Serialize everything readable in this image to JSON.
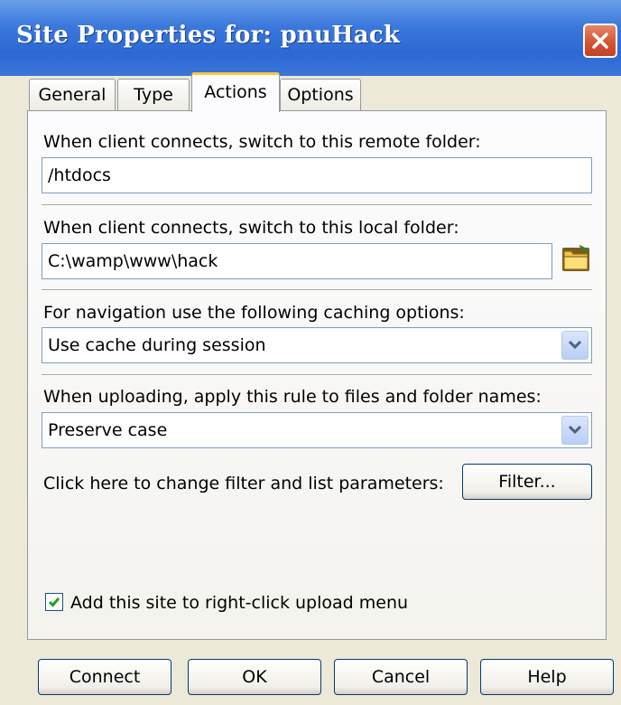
{
  "window": {
    "title": "Site Properties for: pnuHack"
  },
  "tabs": [
    {
      "label": "General"
    },
    {
      "label": "Type"
    },
    {
      "label": "Actions"
    },
    {
      "label": "Options"
    }
  ],
  "active_tab": "Actions",
  "actions": {
    "remote_folder_label": "When client connects, switch to this remote folder:",
    "remote_folder_value": "/htdocs",
    "local_folder_label": "When client connects, switch to this local folder:",
    "local_folder_value": "C:\\wamp\\www\\hack",
    "caching_label": "For navigation use the following caching options:",
    "caching_value": "Use cache during session",
    "upload_label": "When uploading, apply this rule to files and folder names:",
    "upload_value": "Preserve case",
    "filter_label": "Click here to change filter and list parameters:",
    "filter_button": "Filter...",
    "rightclick_label": "Add this site to right-click upload menu",
    "rightclick_checked": true
  },
  "buttons": {
    "connect": "Connect",
    "ok": "OK",
    "cancel": "Cancel",
    "help": "Help"
  },
  "icons": {
    "close": "close-icon",
    "folder": "folder-icon",
    "dropdown": "chevron-down-icon",
    "check": "checkmark-icon"
  },
  "colors": {
    "titlebar": "#2d68d4",
    "close_button": "#d2512f",
    "active_tab_accent": "#ffc83c",
    "dialog_bg": "#ece9d8"
  }
}
